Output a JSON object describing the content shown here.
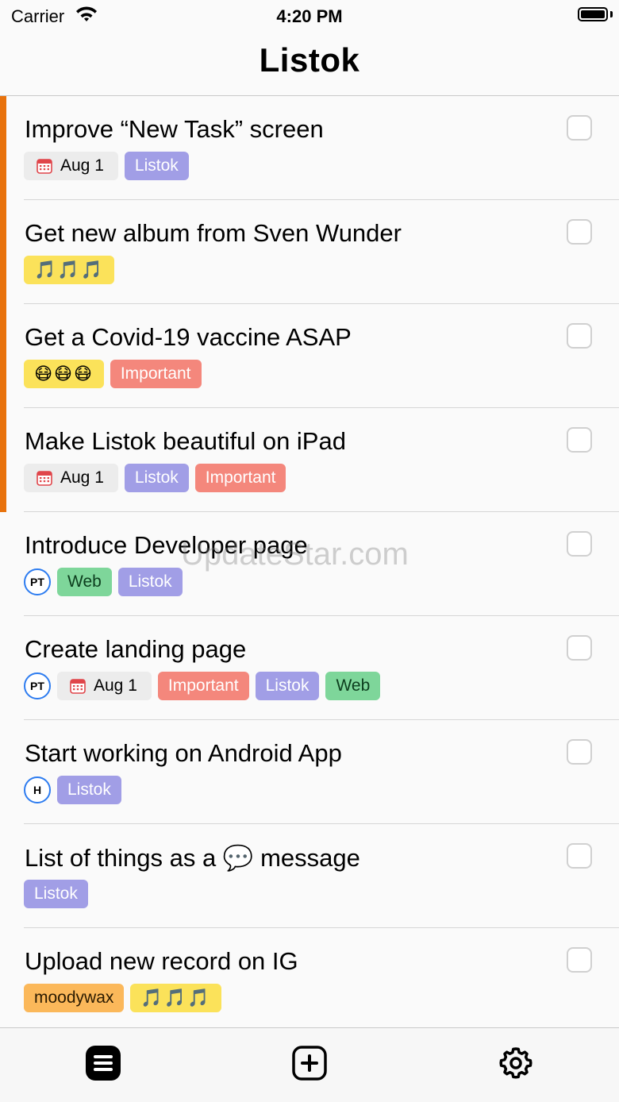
{
  "status_bar": {
    "carrier": "Carrier",
    "time": "4:20 PM"
  },
  "nav": {
    "title": "Listok"
  },
  "tasks": [
    {
      "title": "Improve “New Task” screen",
      "accent": true,
      "tags": [
        {
          "type": "date",
          "label": "Aug 1"
        },
        {
          "type": "listok",
          "label": "Listok"
        }
      ]
    },
    {
      "title": "Get new album from Sven Wunder",
      "accent": true,
      "tags": [
        {
          "type": "music",
          "label": "🎵🎵🎵"
        }
      ]
    },
    {
      "title": "Get a Covid-19 vaccine ASAP",
      "accent": true,
      "tags": [
        {
          "type": "music",
          "label": "😷😷😷"
        },
        {
          "type": "important",
          "label": "Important"
        }
      ]
    },
    {
      "title": "Make Listok beautiful on iPad",
      "accent": true,
      "tags": [
        {
          "type": "date",
          "label": "Aug 1"
        },
        {
          "type": "listok",
          "label": "Listok"
        },
        {
          "type": "important",
          "label": "Important"
        }
      ]
    },
    {
      "title": "Introduce Developer page",
      "accent": false,
      "tags": [
        {
          "type": "avatar",
          "label": "PT"
        },
        {
          "type": "web",
          "label": "Web"
        },
        {
          "type": "listok",
          "label": "Listok"
        }
      ]
    },
    {
      "title": "Create landing page",
      "accent": false,
      "tags": [
        {
          "type": "avatar",
          "label": "PT"
        },
        {
          "type": "date",
          "label": "Aug 1"
        },
        {
          "type": "important",
          "label": "Important"
        },
        {
          "type": "listok",
          "label": "Listok"
        },
        {
          "type": "web",
          "label": "Web"
        }
      ]
    },
    {
      "title": "Start working on Android App",
      "accent": false,
      "tags": [
        {
          "type": "avatar",
          "label": "H"
        },
        {
          "type": "listok",
          "label": "Listok"
        }
      ]
    },
    {
      "title": "List of things as a 💬 message",
      "accent": false,
      "tags": [
        {
          "type": "listok",
          "label": "Listok"
        }
      ]
    },
    {
      "title": "Upload new record on IG",
      "accent": false,
      "tags": [
        {
          "type": "moodywax",
          "label": "moodywax"
        },
        {
          "type": "music",
          "label": "🎵🎵🎵"
        }
      ]
    }
  ],
  "watermark": "UpdateStar.com",
  "tab_bar": {
    "items": [
      {
        "icon": "list-icon"
      },
      {
        "icon": "add-icon"
      },
      {
        "icon": "gear-icon"
      }
    ]
  },
  "colors": {
    "accent": "#e8720c",
    "listok": "#a19ee6",
    "important": "#f4877c",
    "web": "#7ed69a",
    "music": "#fbe25a",
    "moodywax": "#fbb85a",
    "avatar_ring": "#2d7cf0"
  }
}
